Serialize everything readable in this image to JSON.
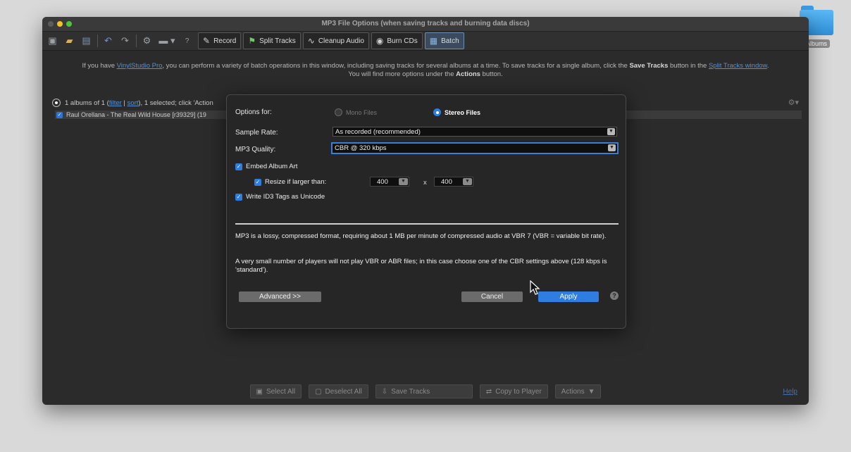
{
  "desktop": {
    "folder_label": "Albums"
  },
  "window": {
    "title": "MP3 File Options (when saving tracks and burning data discs)"
  },
  "toolbar": {
    "icons": [
      "open-icon",
      "folder-open-icon",
      "save-icon",
      "undo-icon",
      "redo-icon",
      "gear-icon",
      "folder-icon",
      "help-icon"
    ],
    "tabs": [
      {
        "label": "Record",
        "icon": "record-icon"
      },
      {
        "label": "Split Tracks",
        "icon": "split-tracks-icon"
      },
      {
        "label": "Cleanup Audio",
        "icon": "cleanup-audio-icon"
      },
      {
        "label": "Burn CDs",
        "icon": "cd-icon"
      },
      {
        "label": "Batch",
        "icon": "batch-icon",
        "active": true
      }
    ]
  },
  "banner": {
    "line1_a": "If you have ",
    "line1_link": "VinylStudio Pro",
    "line1_b": ", you can perform a variety of batch operations in this window, including saving tracks for several albums at a time.  To save tracks for a single album, click the ",
    "line1_bold": "Save Tracks",
    "line1_c": " button in the ",
    "line1_link2": "Split Tracks window",
    "line1_d": ".",
    "line2_a": "You will find more options under the ",
    "line2_bold": "Actions",
    "line2_b": " button."
  },
  "albums": {
    "header_a": "1 albums of 1 (",
    "filter": "filter",
    "sep": " | ",
    "sort": "sort",
    "header_b": "), 1 selected; click 'Action",
    "row": "Raul Orellana - The Real Wild House [r39329] (19"
  },
  "dialog": {
    "options_for_label": "Options for:",
    "mono_label": "Mono Files",
    "stereo_label": "Stereo Files",
    "selected_option": "Stereo Files",
    "sample_rate_label": "Sample Rate:",
    "sample_rate_value": "As recorded (recommended)",
    "quality_label": "MP3 Quality:",
    "quality_value": "CBR @ 320 kbps",
    "embed_art_label": "Embed Album Art",
    "embed_art_checked": true,
    "resize_label": "Resize if larger than:",
    "resize_checked": true,
    "resize_width": "400",
    "resize_x": "x",
    "resize_height": "400",
    "id3_label": "Write ID3 Tags as Unicode",
    "id3_checked": true,
    "desc1": "MP3 is a lossy, compressed format, requiring about 1 MB per minute of compressed audio at VBR 7 (VBR = variable bit rate).",
    "desc2": "A very small number of players will not play VBR or ABR files; in this case choose one of the CBR settings above (128 kbps is 'standard').",
    "advanced_label": "Advanced >>",
    "cancel_label": "Cancel",
    "apply_label": "Apply",
    "help_label": "?"
  },
  "bottombar": {
    "select_all": "Select All",
    "deselect_all": "Deselect All",
    "save_tracks": "Save Tracks",
    "copy_to_player": "Copy to Player",
    "actions": "Actions",
    "help": "Help"
  },
  "colors": {
    "accent": "#2f7de0",
    "link": "#5a8fd0"
  }
}
